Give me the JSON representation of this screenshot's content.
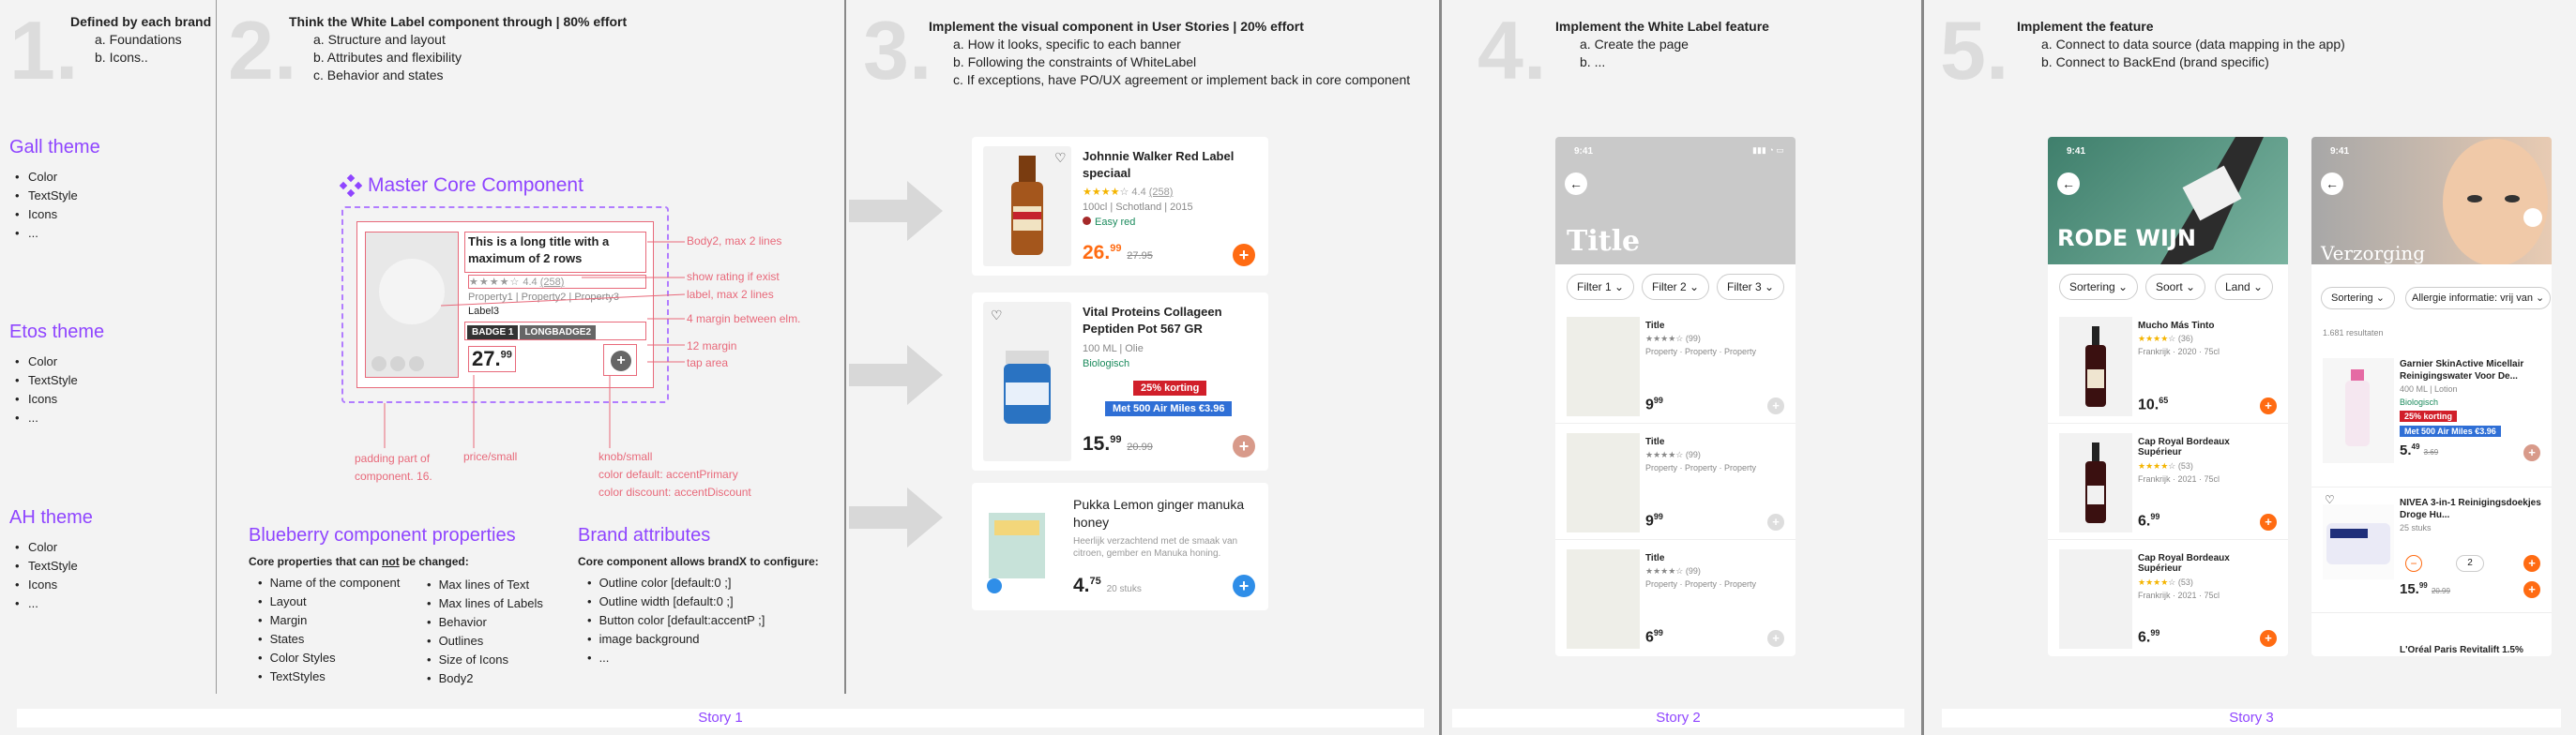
{
  "steps": [
    {
      "num": "1.",
      "title": "Defined by each brand",
      "items": [
        "a. Foundations",
        "b. Icons.."
      ]
    },
    {
      "num": "2.",
      "title": "Think the White Label component through | 80% effort",
      "items": [
        "a. Structure and layout",
        "b. Attributes and flexibility",
        "c. Behavior and states"
      ]
    },
    {
      "num": "3.",
      "title": "Implement the visual component in User Stories | 20% effort",
      "items": [
        "a. How it looks, specific to each banner",
        "b. Following the constraints of WhiteLabel",
        "c. If exceptions, have PO/UX agreement or implement back in core component"
      ]
    },
    {
      "num": "4.",
      "title": "Implement the White Label feature",
      "items": [
        "a. Create the page",
        "b. ..."
      ]
    },
    {
      "num": "5.",
      "title": "Implement the feature",
      "items": [
        "a. Connect to data source (data mapping in the app)",
        "b. Connect to BackEnd (brand specific)"
      ]
    }
  ],
  "themes": [
    {
      "name": "Gall theme",
      "items": [
        "Color",
        "TextStyle",
        "Icons",
        "..."
      ]
    },
    {
      "name": "Etos theme",
      "items": [
        "Color",
        "TextStyle",
        "Icons",
        "..."
      ]
    },
    {
      "name": "AH theme",
      "items": [
        "Color",
        "TextStyle",
        "Icons",
        "..."
      ]
    }
  ],
  "master": {
    "title": "Master Core Component",
    "product_title": "This is a long title with a maximum of 2 rows",
    "rating": "4.4",
    "rating_count": "(258)",
    "properties": "Property1 | Property2 | Property3",
    "label": "Label3",
    "badge1": "BADGE 1",
    "badge2": "LONGBADGE2",
    "price_main": "27.",
    "price_sup": "99",
    "annotations": {
      "body2": "Body2, max 2 lines",
      "rating": "show rating if exist",
      "label": "label, max 2 lines",
      "margin4": "4 margin between elm.",
      "margin12": "12 margin",
      "tap": "tap area",
      "padding": "padding part of component. 16.",
      "price": "price/small",
      "knob": "knob/small",
      "knob_c1": "color default: accentPrimary",
      "knob_c2": "color discount: accentDiscount"
    }
  },
  "blueberry": {
    "title": "Blueberry component properties",
    "subtitle_pre": "Core properties that can ",
    "subtitle_not": "not",
    "subtitle_post": " be changed:",
    "col1": [
      "Name of the component",
      "Layout",
      "Margin",
      "States",
      "Color Styles",
      "TextStyles"
    ],
    "col2": [
      "Max lines of Text",
      "Max lines of Labels",
      "Behavior",
      "Outlines",
      "Size of Icons",
      "Body2"
    ]
  },
  "brand": {
    "title": "Brand attributes",
    "subtitle": "Core component allows brandX to configure:",
    "items": [
      "Outline color [default:0 ;]",
      "Outline width [default:0 ;]",
      "Button color [default:accentP ;]",
      "image background",
      "..."
    ]
  },
  "products": [
    {
      "name": "Johnnie Walker Red Label speciaal",
      "rating": "4.4",
      "count": "(258)",
      "meta": "100cl | Schotland | 2015",
      "tag": "Easy red",
      "price": "26.",
      "sup": "99",
      "old": "27.95"
    },
    {
      "name": "Vital Proteins Collageen Peptiden Pot 567 GR",
      "meta": "100 ML | Olie",
      "tag": "Biologisch",
      "badge1": "25% korting",
      "badge2": "Met 500 Air Miles €3.96",
      "price": "15.",
      "sup": "99",
      "old": "20.99"
    },
    {
      "name": "Pukka Lemon ginger manuka honey",
      "desc": "Heerlijk verzachtend met de smaak van citroen, gember en Manuka honing.",
      "price": "4.",
      "sup": "75",
      "unit": "20 stuks"
    }
  ],
  "story4": {
    "time": "9:41",
    "title": "Title",
    "filters": [
      "Filter 1",
      "Filter 2",
      "Filter 3"
    ],
    "items": [
      {
        "title": "Title",
        "count": "(99)",
        "props": "Property · Property · Property",
        "price": "9",
        "sup": "99"
      },
      {
        "title": "Title",
        "count": "(99)",
        "props": "Property · Property · Property",
        "price": "9",
        "sup": "99"
      },
      {
        "title": "Title",
        "count": "(99)",
        "props": "Property · Property · Property",
        "price": "6",
        "sup": "99"
      }
    ]
  },
  "story5a": {
    "time": "9:41",
    "banner": "RODE WIJN",
    "filters": [
      "Sortering",
      "Soort",
      "Land"
    ],
    "items": [
      {
        "title": "Mucho Más Tinto",
        "count": "(36)",
        "meta": "Frankrijk · 2020 · 75cl",
        "price": "10.",
        "sup": "65"
      },
      {
        "title": "Cap Royal Bordeaux Supérieur",
        "count": "(53)",
        "meta": "Frankrijk · 2021 · 75cl",
        "price": "6.",
        "sup": "99"
      },
      {
        "title": "Cap Royal Bordeaux Supérieur",
        "count": "(53)",
        "meta": "Frankrijk · 2021 · 75cl",
        "price": "6.",
        "sup": "99"
      }
    ]
  },
  "story5b": {
    "time": "9:41",
    "banner": "Verzorging",
    "filters": [
      "Sortering",
      "Allergie informatie: vrij van"
    ],
    "results": "1.681 resultaten",
    "items": [
      {
        "title": "Garnier SkinActive Micellair Reinigingswater Voor De...",
        "meta": "400 ML | Lotion",
        "tag": "Biologisch",
        "badge1": "25% korting",
        "badge2": "Met 500 Air Miles €3.96",
        "price": "5.",
        "sup": "49",
        "old": "3.69"
      },
      {
        "title": "NIVEA 3-in-1 Reinigingsdoekjes Droge Hu...",
        "meta": "25 stuks",
        "qty": "2",
        "price": "15.",
        "sup": "99",
        "old": "20.99"
      },
      {
        "title": "L'Oréal Paris Revitalift 1.5%"
      }
    ]
  },
  "footers": [
    "Story 1",
    "Story 2",
    "Story 3"
  ],
  "colors": {
    "purple": "#8f45ff",
    "annot": "#e8697a",
    "orange": "#ff6b12",
    "blue": "#2f8ee8",
    "green": "#1a8a5c",
    "discount": "#d11f2a"
  }
}
